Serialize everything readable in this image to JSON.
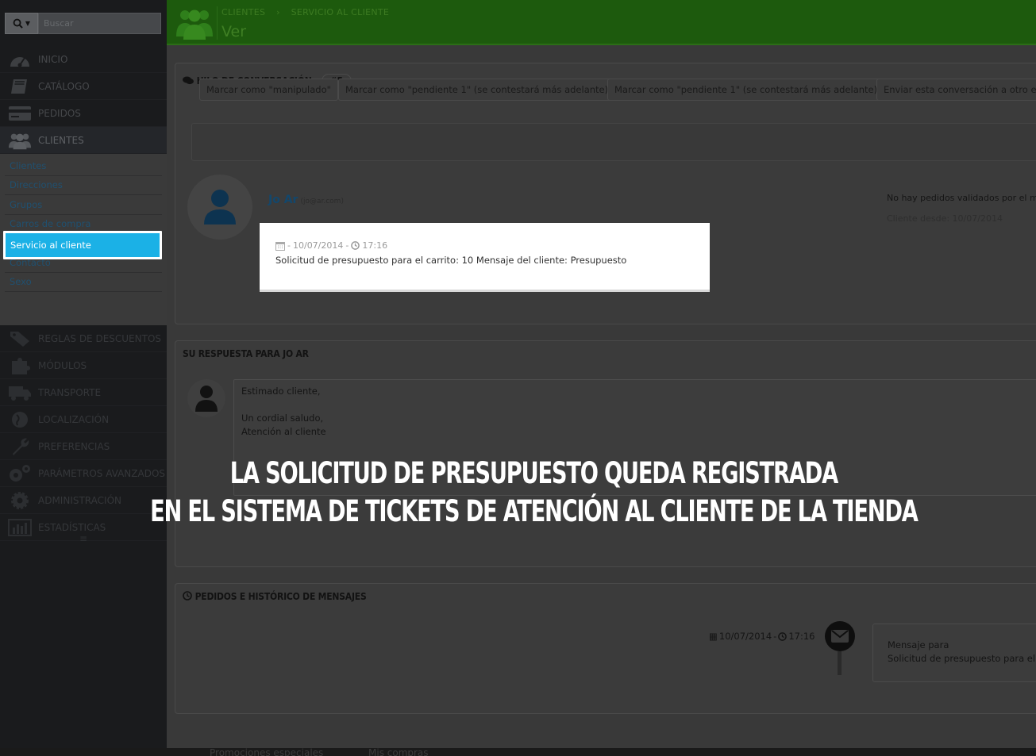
{
  "search": {
    "placeholder": "Buscar"
  },
  "menu": [
    {
      "label": "INICIO",
      "icon": "dashboard-icon"
    },
    {
      "label": "CATÁLOGO",
      "icon": "book-icon"
    },
    {
      "label": "PEDIDOS",
      "icon": "credit-card-icon"
    },
    {
      "label": "CLIENTES",
      "icon": "users-icon"
    }
  ],
  "submenu": [
    "Clientes",
    "Direcciones",
    "Grupos",
    "Carros de compra",
    "Servicio al cliente",
    "Contacto",
    "Sexo"
  ],
  "menu2": [
    {
      "label": "REGLAS DE DESCUENTOS",
      "icon": "tags-icon"
    },
    {
      "label": "MÓDULOS",
      "icon": "puzzle-icon"
    },
    {
      "label": "TRANSPORTE",
      "icon": "truck-icon"
    },
    {
      "label": "LOCALIZACIÓN",
      "icon": "globe-icon"
    },
    {
      "label": "PREFERENCIAS",
      "icon": "wrench-icon"
    },
    {
      "label": "PARÁMETROS AVANZADOS",
      "icon": "cogs-icon"
    },
    {
      "label": "ADMINISTRACIÓN",
      "icon": "cog-icon"
    },
    {
      "label": "ESTADÍSTICAS",
      "icon": "bar-chart-icon"
    }
  ],
  "collapse": "≡",
  "header": {
    "bread1": "CLIENTES",
    "bread2": "SERVICIO AL CLIENTE",
    "title": "Ver"
  },
  "thread": {
    "title": "HILO DE CONVERSACIÓN:",
    "number": "#5",
    "buttons": [
      "Marcar como \"manipulado\"",
      "Marcar como \"pendiente 1\" (se contestará más adelante)",
      "Marcar como \"pendiente 1\" (se contestará más adelante)",
      "Enviar esta conversación a otro e"
    ],
    "customer": {
      "name": "Jo Ar",
      "email": "(jo@ar.com)",
      "info": "No hay pedidos validados por el mo",
      "since": "Cliente desde: 10/07/2014"
    },
    "message": {
      "date": "10/07/2014",
      "time": "17:16",
      "text": "Solicitud de presupuesto para el carrito: 10 Mensaje del cliente: Presupuesto"
    }
  },
  "reply": {
    "title": "SU RESPUESTA PARA JO AR",
    "line1": "Estimado cliente,",
    "line2": "Un cordial saludo,",
    "line3": "Atención al cliente"
  },
  "overlay": {
    "line1": "LA SOLICITUD DE PRESUPUESTO QUEDA REGISTRADA",
    "line2": "EN EL SISTEMA DE TICKETS DE ATENCIÓN AL CLIENTE DE LA TIENDA"
  },
  "history": {
    "title": "PEDIDOS E HISTÓRICO DE MENSAJES",
    "date": "10/07/2014",
    "time": "17:16",
    "msg_title": "Mensaje para",
    "msg_text": "Solicitud de presupuesto para el c"
  },
  "footer": {
    "link1": "Promociones especiales",
    "link2": "Mis compras"
  }
}
